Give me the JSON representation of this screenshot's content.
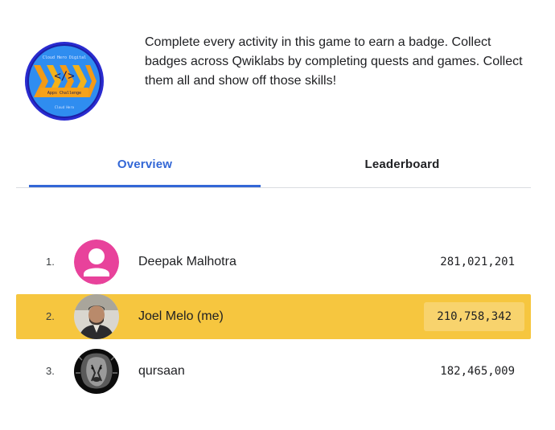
{
  "badge": {
    "title_text": "Cloud Hero Digital",
    "subtitle_text": "Apps Challenge",
    "footer_text": "Cloud Hero",
    "symbol": "</>"
  },
  "description": "Complete every activity in this game to earn a badge. Collect badges across Qwiklabs by completing quests and games. Collect them all and show off those skills!",
  "tabs": [
    {
      "label": "Overview",
      "active": true
    },
    {
      "label": "Leaderboard",
      "active": false
    }
  ],
  "leaderboard": [
    {
      "rank": "1.",
      "name": "Deepak Malhotra",
      "score": "281,021,201",
      "avatar": "default-person-icon",
      "me": false
    },
    {
      "rank": "2.",
      "name": "Joel Melo (me)",
      "score": "210,758,342",
      "avatar": "user-photo",
      "me": true
    },
    {
      "rank": "3.",
      "name": "qursaan",
      "score": "182,465,009",
      "avatar": "lion-photo",
      "me": false
    }
  ],
  "colors": {
    "accent": "#3367d6",
    "highlight_row": "#f6c63f",
    "highlight_score": "#f8d36d",
    "default_avatar": "#e8429b"
  }
}
